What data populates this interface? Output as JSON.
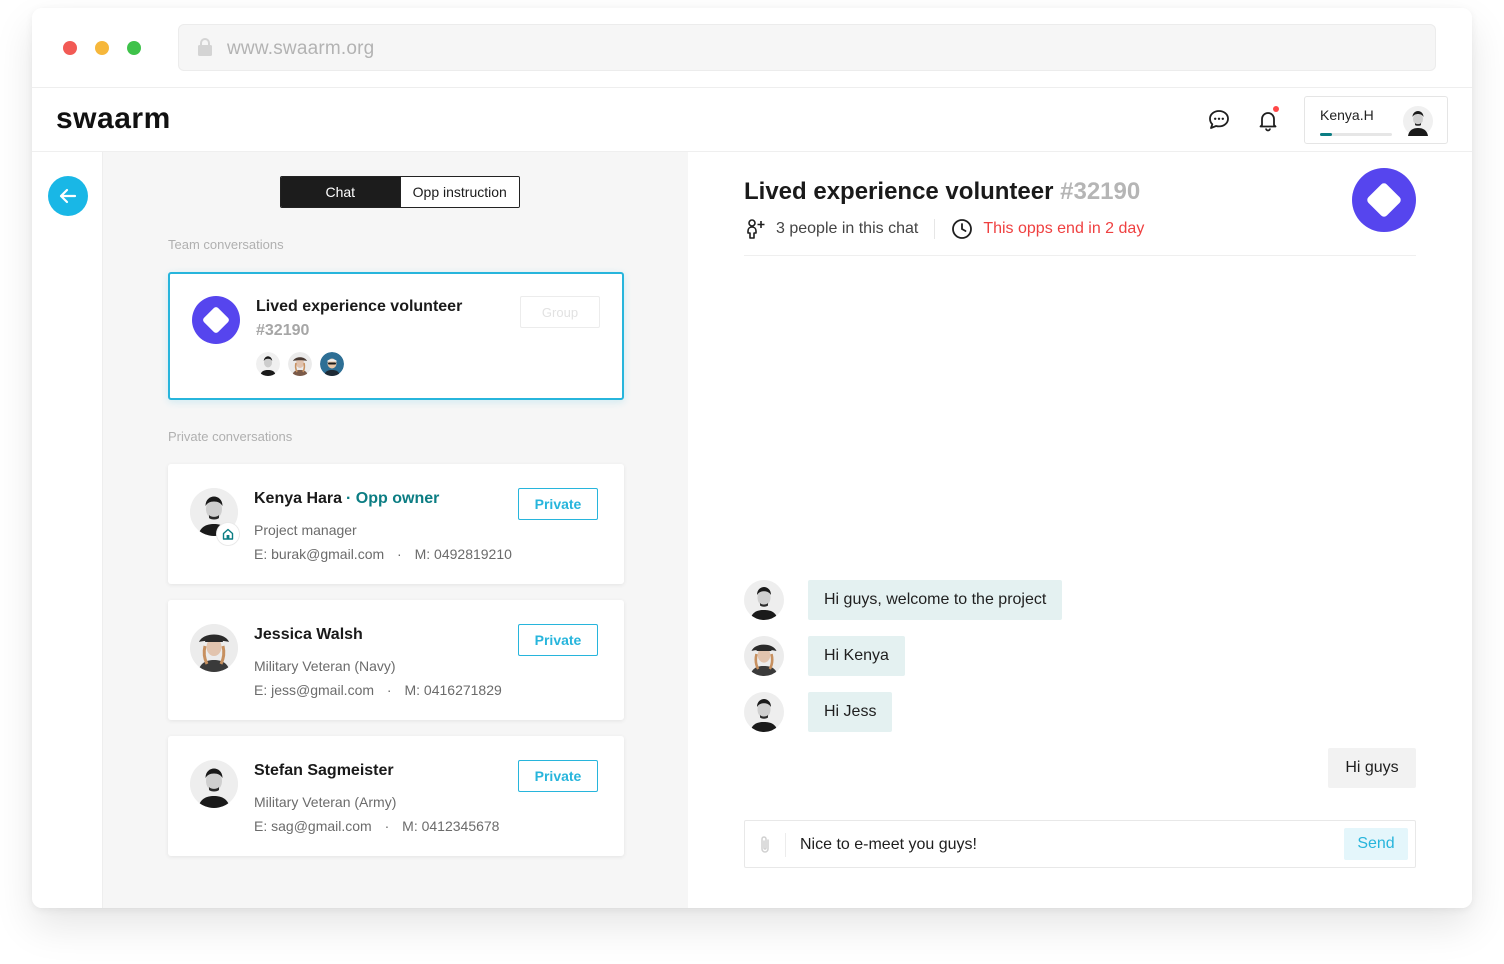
{
  "browser": {
    "url": "www.swaarm.org"
  },
  "header": {
    "logo": "swaarm",
    "user_name": "Kenya.H",
    "user_progress": 0.16
  },
  "tabs": [
    {
      "label": "Chat",
      "active": true
    },
    {
      "label": "Opp instruction",
      "active": false
    }
  ],
  "team_section": {
    "label": "Team conversations",
    "card": {
      "title": "Lived experience volunteer",
      "number": "#32190",
      "button_label": "Group"
    }
  },
  "private_section": {
    "label": "Private conversations",
    "contacts": [
      {
        "name": "Kenya Hara",
        "tag": "Opp owner",
        "role": "Project manager",
        "email": "E: burak@gmail.com",
        "mobile": "M: 0492819210",
        "button_label": "Private"
      },
      {
        "name": "Jessica Walsh",
        "role": "Military Veteran (Navy)",
        "email": "E: jess@gmail.com",
        "mobile": "M: 0416271829",
        "button_label": "Private"
      },
      {
        "name": "Stefan Sagmeister",
        "role": "Military Veteran (Army)",
        "email": "E: sag@gmail.com",
        "mobile": "M: 0412345678",
        "button_label": "Private"
      }
    ]
  },
  "chat": {
    "title": "Lived experience volunteer",
    "number": "#32190",
    "people": "3 people in this chat",
    "deadline": "This opps end in 2 day",
    "messages": [
      {
        "text": "Hi guys, welcome to the project"
      },
      {
        "text": "Hi Kenya"
      },
      {
        "text": "Hi Jess"
      }
    ],
    "my_message": "Hi guys",
    "composer_value": "Nice to e-meet you guys!",
    "send_label": "Send"
  },
  "colors": {
    "accent": "#27b5dc",
    "brand_purple": "#5645ee",
    "owner_teal": "#0b7d83",
    "warning": "#ef4040",
    "bubble": "#e4f1f1"
  },
  "icons": [
    "lock-icon",
    "chat-bubble-icon",
    "bell-icon",
    "arrow-left-icon",
    "person-add-icon",
    "clock-icon",
    "paperclip-icon",
    "house-icon"
  ]
}
